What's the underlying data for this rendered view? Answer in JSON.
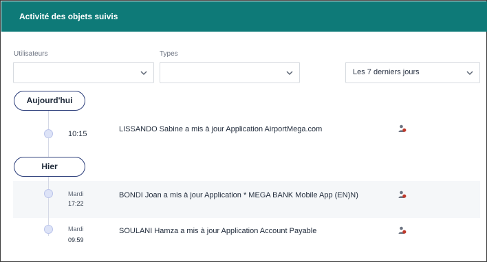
{
  "header": {
    "title": "Activité des objets suivis"
  },
  "filters": {
    "users_label": "Utilisateurs",
    "users_value": "",
    "types_label": "Types",
    "types_value": "",
    "period_value": "Les 7 derniers jours"
  },
  "groups": [
    {
      "label": "Aujourd'hui",
      "items": [
        {
          "day": "",
          "time": "10:15",
          "message": "LISSANDO  Sabine a mis à jour Application AirportMega.com",
          "icon": "user-edit-icon"
        }
      ]
    },
    {
      "label": "Hier",
      "items": [
        {
          "day": "Mardi",
          "time": "17:22",
          "message": "BONDI Joan  a mis à jour Application * MEGA BANK Mobile App (EN)N)",
          "icon": "user-edit-icon"
        },
        {
          "day": "Mardi",
          "time": "09:59",
          "message": "SOULANI Hamza a mis à jour Application Account Payable",
          "icon": "user-edit-icon"
        }
      ]
    }
  ]
}
